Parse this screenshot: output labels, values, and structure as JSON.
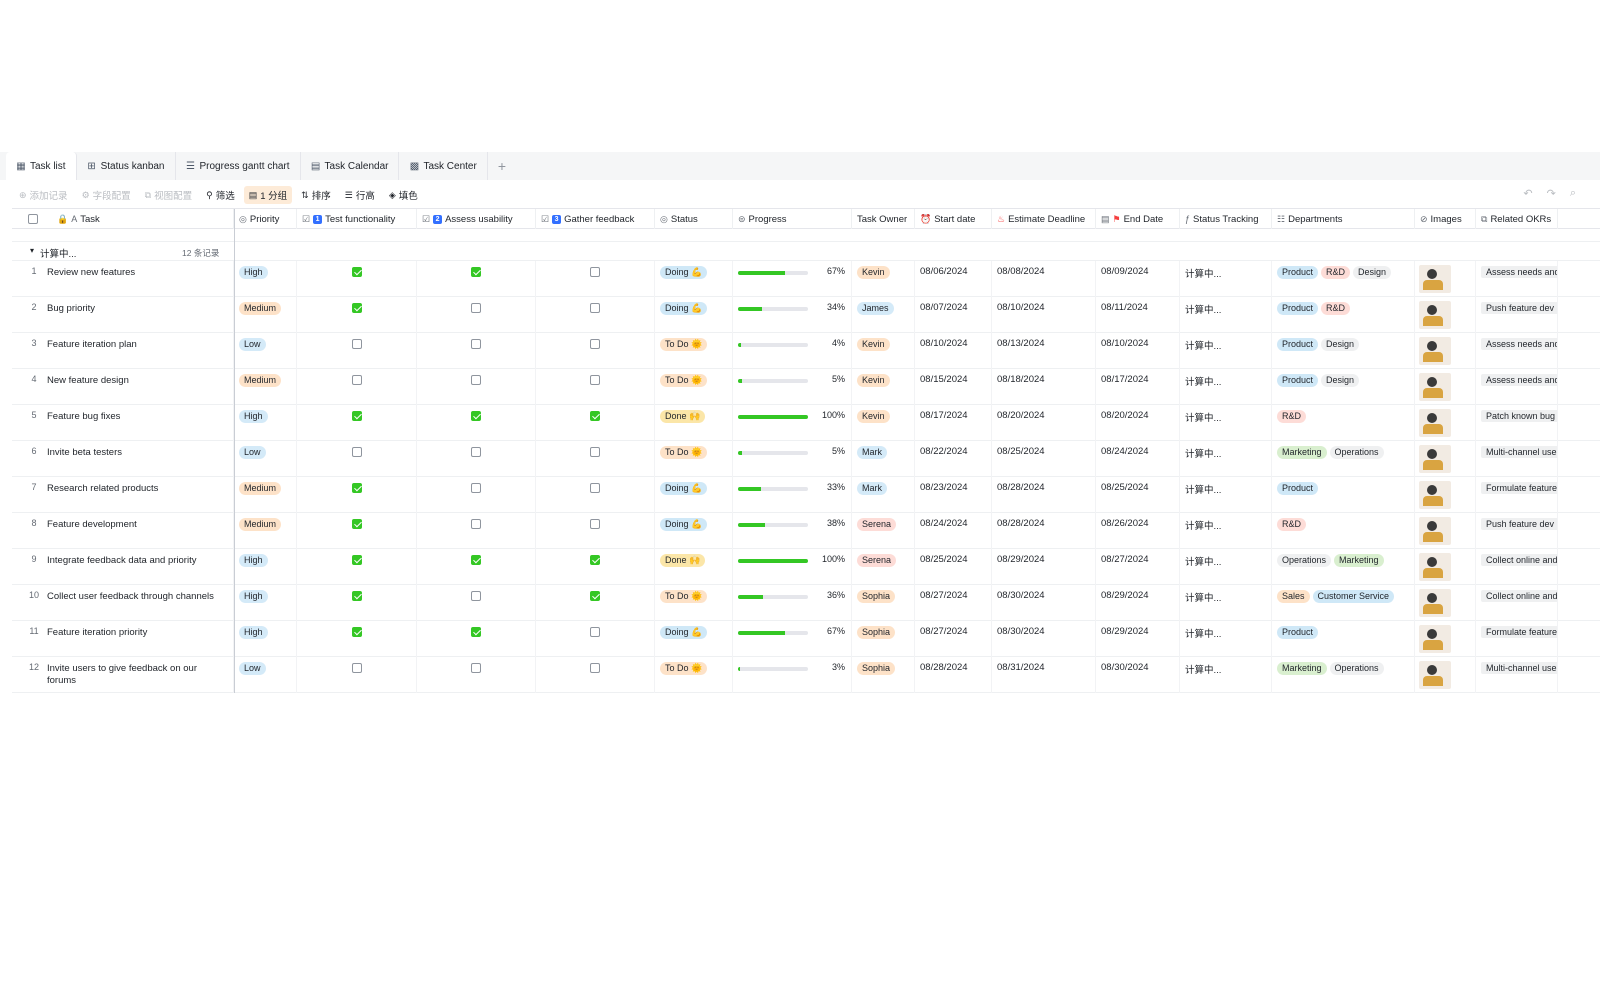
{
  "tabs": [
    {
      "label": "Task list",
      "icon": "table-icon",
      "glyph": "▦"
    },
    {
      "label": "Status kanban",
      "icon": "kanban-icon",
      "glyph": "⊞"
    },
    {
      "label": "Progress gantt chart",
      "icon": "gantt-icon",
      "glyph": "☰"
    },
    {
      "label": "Task Calendar",
      "icon": "calendar-icon",
      "glyph": "▤"
    },
    {
      "label": "Task Center",
      "icon": "grid-icon",
      "glyph": "▩"
    }
  ],
  "toolbar": {
    "add_record": "添加记录",
    "field_config": "字段配置",
    "view_config": "视图配置",
    "filter": "筛选",
    "group": "1 分组",
    "sort": "排序",
    "row_height": "行高",
    "fill_color": "填色"
  },
  "columns": {
    "task": "Task",
    "priority": "Priority",
    "test_functionality": "Test functionality",
    "test_num": "1",
    "assess_usability": "Assess usability",
    "assess_num": "2",
    "gather_feedback": "Gather feedback",
    "gather_num": "3",
    "status": "Status",
    "progress": "Progress",
    "task_owner": "Task Owner",
    "start_date": "Start date",
    "estimate_deadline": "Estimate Deadline",
    "end_date": "End Date",
    "status_tracking": "Status Tracking",
    "departments": "Departments",
    "images": "Images",
    "related_okrs": "Related OKRs"
  },
  "group": {
    "title": "计算中...",
    "count": "12 条记录"
  },
  "colors": {
    "High": "#d4eaf8",
    "Medium": "#fde2c8",
    "Low": "#d4eaf8",
    "Doing": "#cfe8f7",
    "To Do": "#fde2c8",
    "Done": "#fbe6a8",
    "Kevin": "#fde2c8",
    "James": "#d4eaf8",
    "Mark": "#d4eaf8",
    "Serena": "#fddcd7",
    "Sophia": "#fde2c8",
    "Product": "#cfe8f7",
    "R&D": "#fddcd7",
    "Design": "#eff0f1",
    "Marketing": "#d9efcf",
    "Operations": "#eff0f1",
    "Sales": "#fde2c8",
    "Customer Service": "#cfe8f7"
  },
  "rows": [
    {
      "n": "1",
      "task": "Review new features",
      "priority": "High",
      "test": true,
      "assess": true,
      "gather": false,
      "status": "Doing 💪",
      "status_key": "Doing",
      "progress": 0.67,
      "progress_label": "67%",
      "owner": "Kevin",
      "start": "08/06/2024",
      "deadline": "08/08/2024",
      "end": "08/09/2024",
      "tracking": "计算中...",
      "depts": [
        "Product",
        "R&D",
        "Design"
      ],
      "okr": "Assess needs and"
    },
    {
      "n": "2",
      "task": "Bug priority",
      "priority": "Medium",
      "test": true,
      "assess": false,
      "gather": false,
      "status": "Doing 💪",
      "status_key": "Doing",
      "progress": 0.34,
      "progress_label": "34%",
      "owner": "James",
      "start": "08/07/2024",
      "deadline": "08/10/2024",
      "end": "08/11/2024",
      "tracking": "计算中...",
      "depts": [
        "Product",
        "R&D"
      ],
      "okr": "Push feature dev"
    },
    {
      "n": "3",
      "task": "Feature iteration plan",
      "priority": "Low",
      "test": false,
      "assess": false,
      "gather": false,
      "status": "To Do 🌞",
      "status_key": "To Do",
      "progress": 0.04,
      "progress_label": "4%",
      "owner": "Kevin",
      "start": "08/10/2024",
      "deadline": "08/13/2024",
      "end": "08/10/2024",
      "tracking": "计算中...",
      "depts": [
        "Product",
        "Design"
      ],
      "okr": "Assess needs and"
    },
    {
      "n": "4",
      "task": "New feature design",
      "priority": "Medium",
      "test": false,
      "assess": false,
      "gather": false,
      "status": "To Do 🌞",
      "status_key": "To Do",
      "progress": 0.05,
      "progress_label": "5%",
      "owner": "Kevin",
      "start": "08/15/2024",
      "deadline": "08/18/2024",
      "end": "08/17/2024",
      "tracking": "计算中...",
      "depts": [
        "Product",
        "Design"
      ],
      "okr": "Assess needs and"
    },
    {
      "n": "5",
      "task": "Feature bug fixes",
      "priority": "High",
      "test": true,
      "assess": true,
      "gather": true,
      "status": "Done 🙌",
      "status_key": "Done",
      "progress": 1.0,
      "progress_label": "100%",
      "owner": "Kevin",
      "start": "08/17/2024",
      "deadline": "08/20/2024",
      "end": "08/20/2024",
      "tracking": "计算中...",
      "depts": [
        "R&D"
      ],
      "okr": "Patch known bug"
    },
    {
      "n": "6",
      "task": "Invite beta testers",
      "priority": "Low",
      "test": false,
      "assess": false,
      "gather": false,
      "status": "To Do 🌞",
      "status_key": "To Do",
      "progress": 0.05,
      "progress_label": "5%",
      "owner": "Mark",
      "start": "08/22/2024",
      "deadline": "08/25/2024",
      "end": "08/24/2024",
      "tracking": "计算中...",
      "depts": [
        "Marketing",
        "Operations"
      ],
      "okr": "Multi-channel use"
    },
    {
      "n": "7",
      "task": "Research related products",
      "priority": "Medium",
      "test": true,
      "assess": false,
      "gather": false,
      "status": "Doing 💪",
      "status_key": "Doing",
      "progress": 0.33,
      "progress_label": "33%",
      "owner": "Mark",
      "start": "08/23/2024",
      "deadline": "08/28/2024",
      "end": "08/25/2024",
      "tracking": "计算中...",
      "depts": [
        "Product"
      ],
      "okr": "Formulate feature"
    },
    {
      "n": "8",
      "task": "Feature development",
      "priority": "Medium",
      "test": true,
      "assess": false,
      "gather": false,
      "status": "Doing 💪",
      "status_key": "Doing",
      "progress": 0.38,
      "progress_label": "38%",
      "owner": "Serena",
      "start": "08/24/2024",
      "deadline": "08/28/2024",
      "end": "08/26/2024",
      "tracking": "计算中...",
      "depts": [
        "R&D"
      ],
      "okr": "Push feature dev"
    },
    {
      "n": "9",
      "task": "Integrate feedback data and priority",
      "priority": "High",
      "test": true,
      "assess": true,
      "gather": true,
      "status": "Done 🙌",
      "status_key": "Done",
      "progress": 1.0,
      "progress_label": "100%",
      "owner": "Serena",
      "start": "08/25/2024",
      "deadline": "08/29/2024",
      "end": "08/27/2024",
      "tracking": "计算中...",
      "depts": [
        "Operations",
        "Marketing"
      ],
      "okr": "Collect online and"
    },
    {
      "n": "10",
      "task": "Collect user feedback through channels",
      "priority": "High",
      "test": true,
      "assess": false,
      "gather": true,
      "status": "To Do 🌞",
      "status_key": "To Do",
      "progress": 0.36,
      "progress_label": "36%",
      "owner": "Sophia",
      "start": "08/27/2024",
      "deadline": "08/30/2024",
      "end": "08/29/2024",
      "tracking": "计算中...",
      "depts": [
        "Sales",
        "Customer Service"
      ],
      "okr": "Collect online and"
    },
    {
      "n": "11",
      "task": "Feature iteration priority",
      "priority": "High",
      "test": true,
      "assess": true,
      "gather": false,
      "status": "Doing 💪",
      "status_key": "Doing",
      "progress": 0.67,
      "progress_label": "67%",
      "owner": "Sophia",
      "start": "08/27/2024",
      "deadline": "08/30/2024",
      "end": "08/29/2024",
      "tracking": "计算中...",
      "depts": [
        "Product"
      ],
      "okr": "Formulate feature"
    },
    {
      "n": "12",
      "task": "Invite users to give feedback on our forums",
      "priority": "Low",
      "test": false,
      "assess": false,
      "gather": false,
      "status": "To Do 🌞",
      "status_key": "To Do",
      "progress": 0.03,
      "progress_label": "3%",
      "owner": "Sophia",
      "start": "08/28/2024",
      "deadline": "08/31/2024",
      "end": "08/30/2024",
      "tracking": "计算中...",
      "depts": [
        "Marketing",
        "Operations"
      ],
      "okr": "Multi-channel use"
    }
  ]
}
